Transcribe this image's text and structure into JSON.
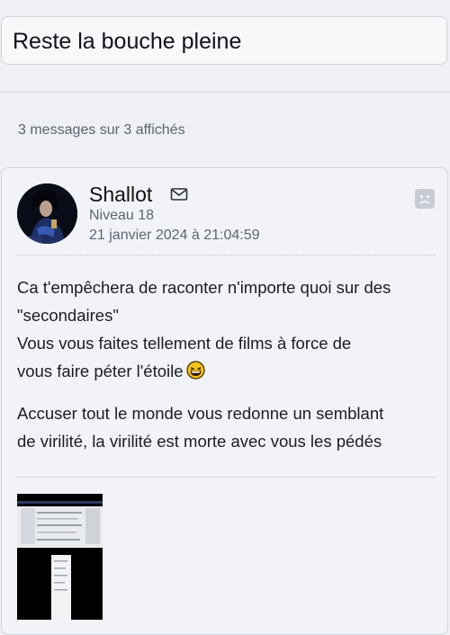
{
  "topic": {
    "title": "Reste la bouche pleine"
  },
  "pagination": {
    "count_text": "3 messages sur 3 affichés"
  },
  "post": {
    "author": "Shallot",
    "level": "Niveau 18",
    "date": "21 janvier 2024 à 21:04:59",
    "paragraph1": {
      "line1": "Ca t'empêchera de raconter n'importe quoi sur des",
      "line2": "\"secondaires\"",
      "line3": "Vous vous faites tellement de films à force de",
      "line4": "vous faire péter l'étoile"
    },
    "paragraph2": {
      "line1": "Accuser tout le monde vous redonne un semblant",
      "line2": "de virilité, la virilité est morte avec vous les pédés"
    },
    "icons": {
      "mail": "mail-icon",
      "report": "report-icon",
      "emoji": "laughing-emoji"
    },
    "colors": {
      "card_bg": "#f1f3f9",
      "page_bg": "#eef0f3",
      "muted_text": "#5e6672"
    }
  }
}
